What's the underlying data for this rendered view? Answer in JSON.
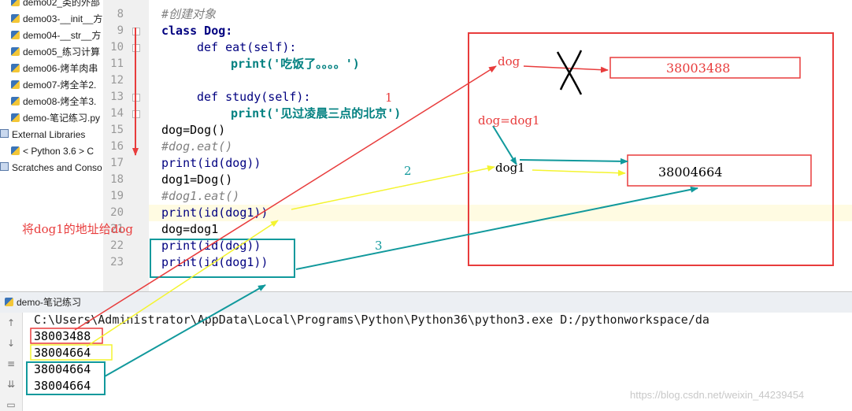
{
  "sidebar": {
    "items": [
      {
        "label": "demo02_类的外部"
      },
      {
        "label": "demo03-__init__方"
      },
      {
        "label": "demo04-__str__方"
      },
      {
        "label": "demo05_练习计算"
      },
      {
        "label": "demo06-烤羊肉串"
      },
      {
        "label": "demo07-烤全羊2."
      },
      {
        "label": "demo08-烤全羊3."
      },
      {
        "label": "demo-笔记练习.py"
      }
    ],
    "external_libraries": "External Libraries",
    "python_sdk": "< Python 3.6 > C",
    "scratches": "Scratches and Conso"
  },
  "editor": {
    "lines": [
      {
        "num": "8",
        "text": "#创建对象"
      },
      {
        "num": "9",
        "text": "class Dog:"
      },
      {
        "num": "10",
        "text": "def eat(self):"
      },
      {
        "num": "11",
        "text": "print('吃饭了。。。。')"
      },
      {
        "num": "12",
        "text": ""
      },
      {
        "num": "13",
        "text": "def study(self):"
      },
      {
        "num": "14",
        "text": "print('见过凌晨三点的北京')"
      },
      {
        "num": "15",
        "text": "dog=Dog()"
      },
      {
        "num": "16",
        "text": "#dog.eat()"
      },
      {
        "num": "17",
        "text": "print(id(dog))"
      },
      {
        "num": "18",
        "text": "dog1=Dog()"
      },
      {
        "num": "19",
        "text": "#dog1.eat()"
      },
      {
        "num": "20",
        "text": "print(id(dog1))"
      },
      {
        "num": "21",
        "text": "dog=dog1"
      },
      {
        "num": "22",
        "text": "print(id(dog))"
      },
      {
        "num": "23",
        "text": "print(id(dog1))"
      }
    ]
  },
  "tab": {
    "label": "demo-笔记练习"
  },
  "console": {
    "command": "C:\\Users\\Administrator\\AppData\\Local\\Programs\\Python\\Python36\\python3.exe D:/pythonworkspace/da",
    "outputs": [
      "38003488",
      "38004664",
      "38004664",
      "38004664"
    ]
  },
  "annotations": {
    "side_note": "将dog1的地址给dog",
    "dog_label": "dog",
    "addr_old": "38003488",
    "assign_label": "dog=dog1",
    "dog1_label": "dog1",
    "addr_new": "38004664",
    "arrow_num_1": "1",
    "arrow_num_2": "2",
    "arrow_num_3": "3"
  },
  "watermark": "https://blog.csdn.net/weixin_44239454",
  "colors": {
    "red": "#e83c3c",
    "yellow": "#f4f430",
    "teal": "#11999c"
  }
}
